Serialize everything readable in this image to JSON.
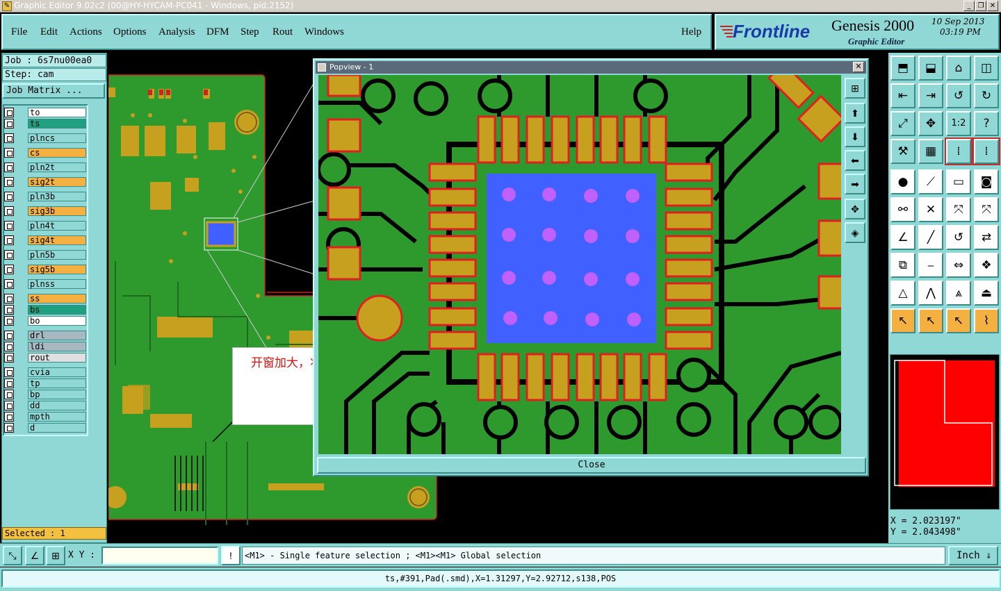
{
  "window": {
    "title": "Graphic Editor 9.02c2 (00@HY-HYCAM-PC041 - Windows, pid:2152)",
    "controls": [
      "_",
      "❐",
      "✕"
    ]
  },
  "menu": {
    "items": [
      "File",
      "Edit",
      "Actions",
      "Options",
      "Analysis",
      "DFM",
      "Step",
      "Rout",
      "Windows"
    ],
    "help": "Help"
  },
  "brand": {
    "logo": "Frontline",
    "product": "Genesis 2000",
    "subtitle": "Graphic Editor",
    "date": "10 Sep 2013",
    "time": "03:19 PM"
  },
  "job": {
    "job_label": "Job : 6s7nu00ea0",
    "step_label": "Step: cam",
    "matrix_button": "Job Matrix ..."
  },
  "layers": [
    {
      "name": "to",
      "color": "#ffffff"
    },
    {
      "name": "ts",
      "color": "#20a080"
    },
    {
      "name": "plncs",
      "color": "#8fd8d6"
    },
    {
      "name": "cs",
      "color": "#f4b040"
    },
    {
      "name": "pln2t",
      "color": "#8fd8d6"
    },
    {
      "name": "sig2t",
      "color": "#f4b040"
    },
    {
      "name": "pln3b",
      "color": "#8fd8d6"
    },
    {
      "name": "sig3b",
      "color": "#f4b040"
    },
    {
      "name": "pln4t",
      "color": "#8fd8d6"
    },
    {
      "name": "sig4t",
      "color": "#f4b040"
    },
    {
      "name": "pln5b",
      "color": "#8fd8d6"
    },
    {
      "name": "sig5b",
      "color": "#f4b040"
    },
    {
      "name": "plnss",
      "color": "#8fd8d6"
    },
    {
      "name": "ss",
      "color": "#f4b040"
    },
    {
      "name": "bs",
      "color": "#20a080"
    },
    {
      "name": "bo",
      "color": "#ffffff"
    },
    {
      "name": "drl",
      "color": "#a8b8c0"
    },
    {
      "name": "ldi",
      "color": "#a8b8c0"
    },
    {
      "name": "rout",
      "color": "#e0e0e0"
    },
    {
      "name": "cvia",
      "color": "#8fd8d6"
    },
    {
      "name": "tp",
      "color": "#8fd8d6"
    },
    {
      "name": "bp",
      "color": "#8fd8d6"
    },
    {
      "name": "dd",
      "color": "#8fd8d6"
    },
    {
      "name": "mpth",
      "color": "#8fd8d6"
    },
    {
      "name": "d",
      "color": "#8fd8d6"
    }
  ],
  "selected": "Selected : 1",
  "popview": {
    "title": "Popview - 1",
    "close": "Close"
  },
  "annotation": "开窗加大，将焊盘开出",
  "coords": {
    "x": "X = 2.023197\"",
    "y": "Y = 2.043498\""
  },
  "bottom": {
    "xy_label": "X Y :",
    "xy_value": "",
    "message": "<M1> - Single feature selection ; <M1><M1> Global selection",
    "unit": "Inch"
  },
  "status": "ts,#391,Pad(.smd),X=1.31297,Y=2.92712,s138,POS",
  "colors": {
    "ui_teal": "#8fd8d6",
    "board_green": "#2e9a2e",
    "pad_gold": "#c8a020",
    "pad_outline": "#e02020",
    "thermal_blue": "#4060ff",
    "via_purple": "#c060ff"
  }
}
